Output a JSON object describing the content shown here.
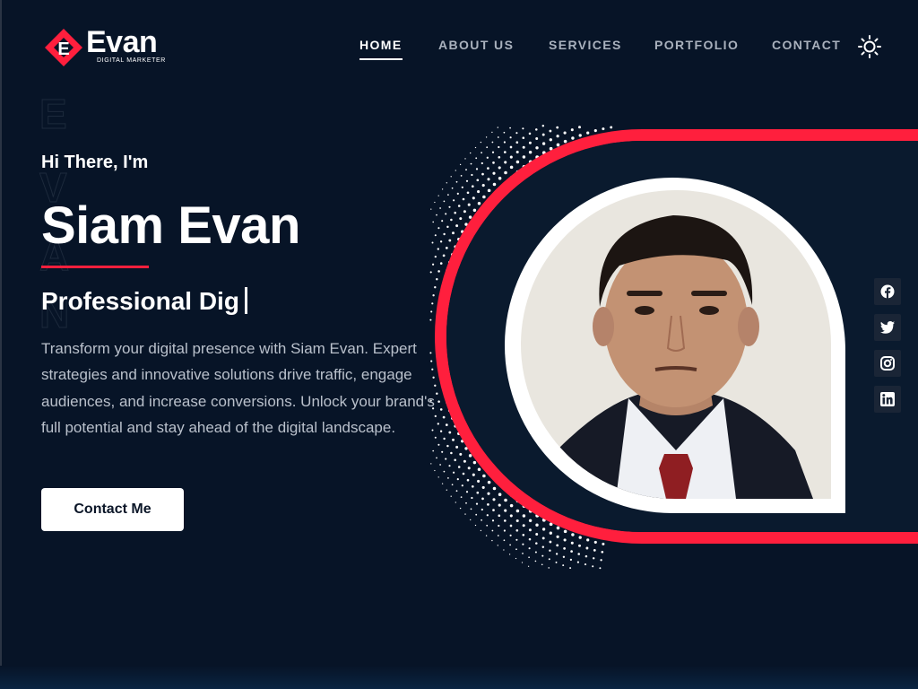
{
  "brand": {
    "name": "Evan",
    "tagline": "DIGITAL MARKETER",
    "mark_letter": "E"
  },
  "nav": {
    "items": [
      {
        "label": "HOME",
        "active": true
      },
      {
        "label": "ABOUT US",
        "active": false
      },
      {
        "label": "SERVICES",
        "active": false
      },
      {
        "label": "PORTFOLIO",
        "active": false
      },
      {
        "label": "CONTACT",
        "active": false
      }
    ],
    "theme_toggle_icon": "sun-icon"
  },
  "hero": {
    "watermark": [
      "E",
      "V",
      "A",
      "N"
    ],
    "greeting": "Hi There, I'm",
    "name": "Siam Evan",
    "role_typed": "Professional Dig",
    "description": "Transform your digital presence with Siam Evan. Expert strategies and innovative solutions drive traffic, engage audiences, and increase conversions. Unlock your brand's full potential and stay ahead of the digital landscape.",
    "cta_label": "Contact Me"
  },
  "socials": [
    {
      "icon": "facebook-icon"
    },
    {
      "icon": "twitter-icon"
    },
    {
      "icon": "instagram-icon"
    },
    {
      "icon": "linkedin-icon"
    }
  ],
  "colors": {
    "background": "#071427",
    "accent": "#ff1f3d",
    "text": "#ffffff",
    "muted": "#b9c0cb"
  }
}
